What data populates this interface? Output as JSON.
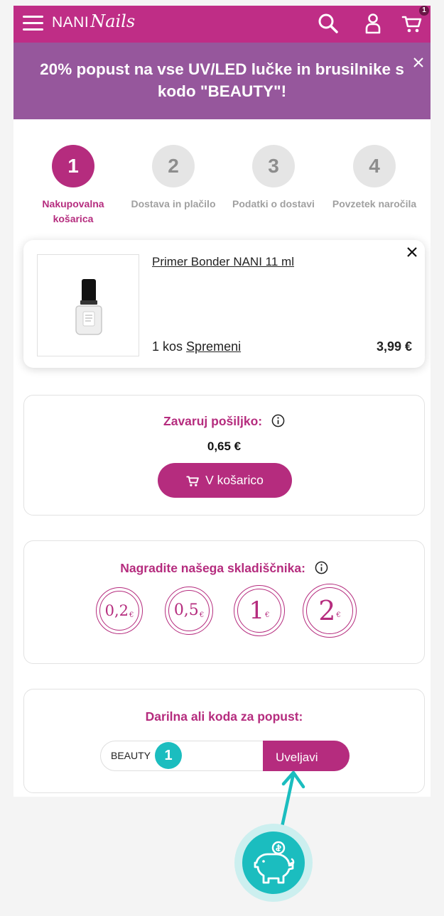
{
  "header": {
    "logo_part1": "NANI",
    "logo_part2": "Nails",
    "cart_count": "1",
    "brand_color": "#bf2d86"
  },
  "promo": {
    "text": "20% popust na vse UV/LED lučke in brusilnike s kodo \"BEAUTY\"!",
    "background": "#96579c"
  },
  "steps": [
    {
      "number": "1",
      "label": "Nakupovalna košarica",
      "active": true
    },
    {
      "number": "2",
      "label": "Dostava in plačilo",
      "active": false
    },
    {
      "number": "3",
      "label": "Podatki o dostavi",
      "active": false
    },
    {
      "number": "4",
      "label": "Povzetek naročila",
      "active": false
    }
  ],
  "cart_item": {
    "name": "Primer Bonder NANI 11 ml",
    "quantity": "1 kos",
    "change_link": "Spremeni",
    "price": "3,99 €"
  },
  "insurance": {
    "title": "Zavaruj pošiljko:",
    "price": "0,65 €",
    "button_label": "V košarico"
  },
  "tip": {
    "title": "Nagradite našega skladiščnika:",
    "coins": [
      {
        "value": "0,2",
        "currency": "€"
      },
      {
        "value": "0,5",
        "currency": "€"
      },
      {
        "value": "1",
        "currency": "€"
      },
      {
        "value": "2",
        "currency": "€"
      }
    ]
  },
  "discount": {
    "title": "Darilna ali koda za popust:",
    "input_value": "BEAUTY",
    "step_marker": "1",
    "apply_label": "Uveljavi"
  },
  "accent_color": "#b52c7e",
  "hint_color": "#1bbdbf"
}
